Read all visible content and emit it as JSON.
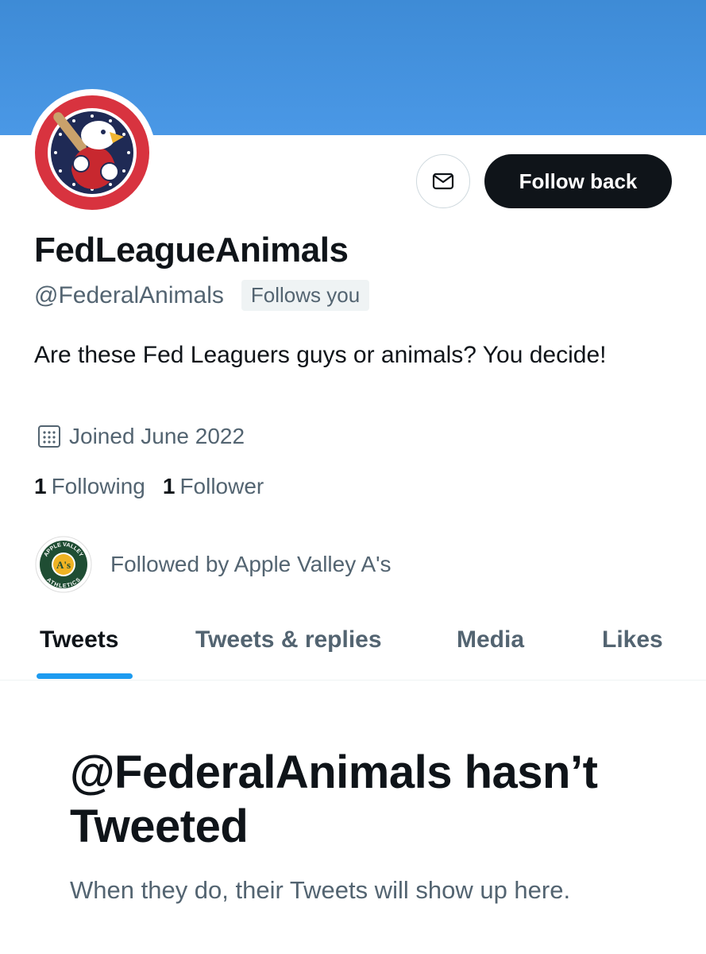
{
  "colors": {
    "banner": "#4a98e6",
    "primary_text": "#0f1419",
    "secondary_text": "#536471",
    "accent": "#1d9bf0",
    "follow_button_bg": "#0f1419"
  },
  "profile": {
    "avatar_icon": "eagle-baseball-logo",
    "display_name": "FedLeagueAnimals",
    "handle": "@FederalAnimals",
    "follows_you_badge": "Follows you",
    "bio": "Are these Fed Leaguers guys or animals? You decide!",
    "joined_icon": "calendar-icon",
    "joined": "Joined June 2022",
    "following_count": "1",
    "following_label": "Following",
    "followers_count": "1",
    "followers_label": "Follower"
  },
  "actions": {
    "message_icon": "envelope-icon",
    "follow_back_label": "Follow back"
  },
  "followed_by": {
    "logo": "apple-valley-athletics-logo",
    "logo_text_top": "APPLE VALLEY",
    "logo_text_center": "A's",
    "logo_text_bottom": "ATHLETICS",
    "text": "Followed by Apple Valley A's"
  },
  "tabs": [
    {
      "label": "Tweets",
      "active": true
    },
    {
      "label": "Tweets & replies",
      "active": false
    },
    {
      "label": "Media",
      "active": false
    },
    {
      "label": "Likes",
      "active": false
    }
  ],
  "empty_state": {
    "title": "@FederalAnimals hasn’t Tweeted",
    "subtitle": "When they do, their Tweets will show up here."
  }
}
